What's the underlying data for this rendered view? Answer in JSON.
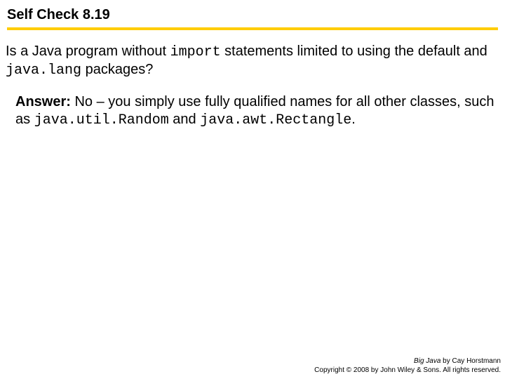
{
  "title": "Self Check 8.19",
  "question": {
    "p1": "Is a Java program without ",
    "c1": "import",
    "p2": " statements limited to using the default and ",
    "c2": "java.lang",
    "p3": " packages?"
  },
  "answer": {
    "label": "Answer:",
    "p1": " No – you simply use fully qualified names for all other classes, such as ",
    "c1": "java.util.Random",
    "p2": " and ",
    "c2": "java.awt.Rectangle",
    "p3": "."
  },
  "footer": {
    "book": "Big Java",
    "byline": " by Cay Horstmann",
    "copyright": "Copyright © 2008 by John Wiley & Sons. All rights reserved."
  }
}
